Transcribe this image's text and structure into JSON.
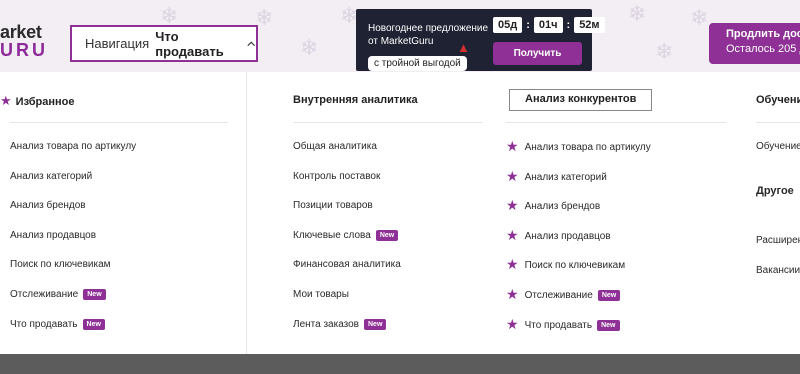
{
  "header": {
    "logo": {
      "top": "arket",
      "bottom": "URU"
    },
    "nav": {
      "label": "Навигация",
      "value": "Что продавать"
    },
    "promo": {
      "line1": "Новогоднее предложение",
      "line2": "от MarketGuru",
      "pill": "с тройной выгодой",
      "timer": [
        "05д",
        "01ч",
        "52м"
      ],
      "button": "Получить"
    },
    "extend": {
      "title": "Продлить дос",
      "subtitle": "Осталось 205 д"
    }
  },
  "colors": {
    "accent": "#8e3096",
    "promo_bg": "#1f2233",
    "header_bg": "#f2eef4"
  },
  "columns": {
    "favorites": {
      "title": "Избранное",
      "items": [
        {
          "label": "Анализ товара по артикулу",
          "badge": ""
        },
        {
          "label": "Анализ категорий",
          "badge": ""
        },
        {
          "label": "Анализ брендов",
          "badge": ""
        },
        {
          "label": "Анализ продавцов",
          "badge": ""
        },
        {
          "label": "Поиск по ключевикам",
          "badge": ""
        },
        {
          "label": "Отслеживание",
          "badge": "New"
        },
        {
          "label": "Что продавать",
          "badge": "New"
        }
      ]
    },
    "internal": {
      "title": "Внутренняя аналитика",
      "items": [
        {
          "label": "Общая аналитика",
          "badge": ""
        },
        {
          "label": "Контроль поставок",
          "badge": ""
        },
        {
          "label": "Позиции товаров",
          "badge": ""
        },
        {
          "label": "Ключевые слова",
          "badge": "New"
        },
        {
          "label": "Финансовая аналитика",
          "badge": ""
        },
        {
          "label": "Мои товары",
          "badge": ""
        },
        {
          "label": "Лента заказов",
          "badge": "New"
        }
      ]
    },
    "competitors": {
      "title": "Анализ конкурентов",
      "items": [
        {
          "label": "Анализ товара по артикулу",
          "badge": ""
        },
        {
          "label": "Анализ категорий",
          "badge": ""
        },
        {
          "label": "Анализ брендов",
          "badge": ""
        },
        {
          "label": "Анализ продавцов",
          "badge": ""
        },
        {
          "label": "Поиск по ключевикам",
          "badge": ""
        },
        {
          "label": "Отслеживание",
          "badge": "New"
        },
        {
          "label": "Что продавать",
          "badge": "New"
        }
      ]
    },
    "training": {
      "title": "Обучение",
      "item": "Обучение",
      "other_title": "Другое",
      "other_items": [
        "Расширение",
        "Вакансии"
      ]
    }
  }
}
